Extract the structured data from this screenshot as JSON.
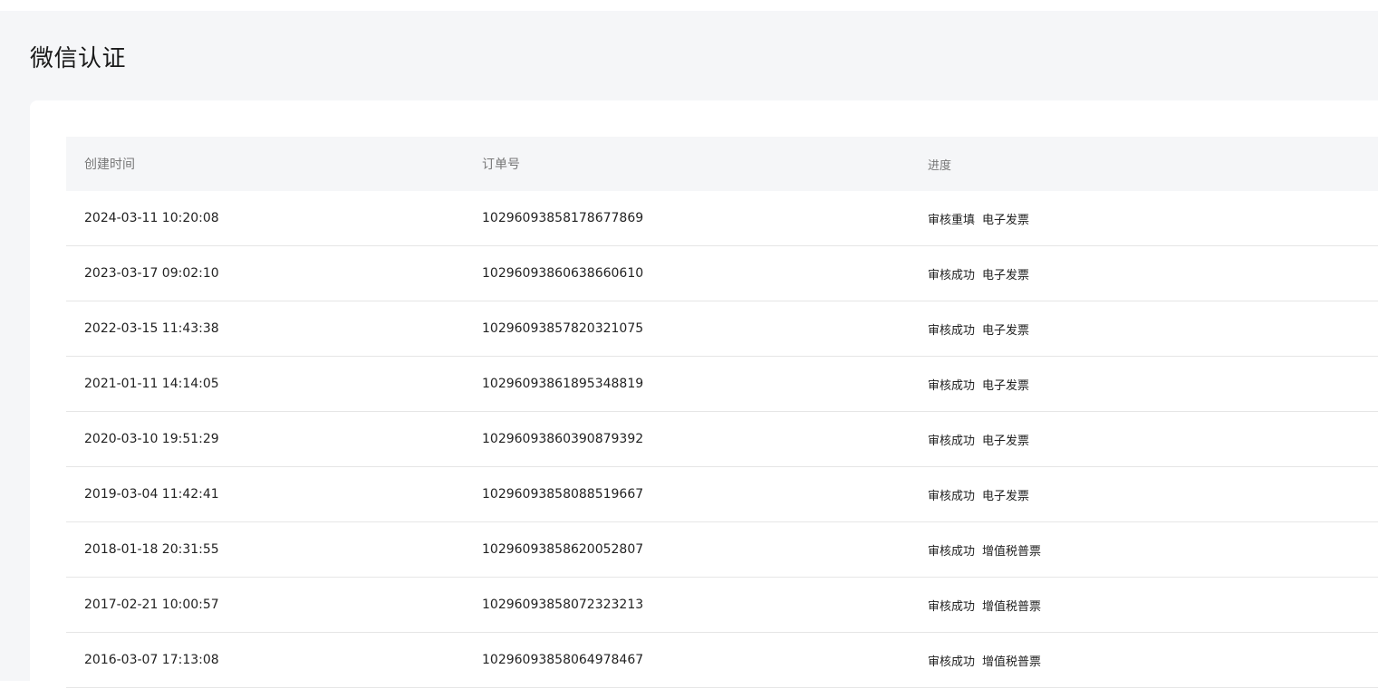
{
  "page": {
    "title": "微信认证"
  },
  "table": {
    "headers": {
      "time": "创建时间",
      "order": "订单号",
      "progress": "进度"
    },
    "rows": [
      {
        "time": "2024-03-11 10:20:08",
        "order": "10296093858178677869",
        "status": "审核重填",
        "invoice": "电子发票"
      },
      {
        "time": "2023-03-17 09:02:10",
        "order": "10296093860638660610",
        "status": "审核成功",
        "invoice": "电子发票"
      },
      {
        "time": "2022-03-15 11:43:38",
        "order": "10296093857820321075",
        "status": "审核成功",
        "invoice": "电子发票"
      },
      {
        "time": "2021-01-11 14:14:05",
        "order": "10296093861895348819",
        "status": "审核成功",
        "invoice": "电子发票"
      },
      {
        "time": "2020-03-10 19:51:29",
        "order": "10296093860390879392",
        "status": "审核成功",
        "invoice": "电子发票"
      },
      {
        "time": "2019-03-04 11:42:41",
        "order": "10296093858088519667",
        "status": "审核成功",
        "invoice": "电子发票"
      },
      {
        "time": "2018-01-18 20:31:55",
        "order": "10296093858620052807",
        "status": "审核成功",
        "invoice": "增值税普票"
      },
      {
        "time": "2017-02-21 10:00:57",
        "order": "10296093858072323213",
        "status": "审核成功",
        "invoice": "增值税普票"
      },
      {
        "time": "2016-03-07 17:13:08",
        "order": "10296093858064978467",
        "status": "审核成功",
        "invoice": "增值税普票"
      }
    ]
  }
}
